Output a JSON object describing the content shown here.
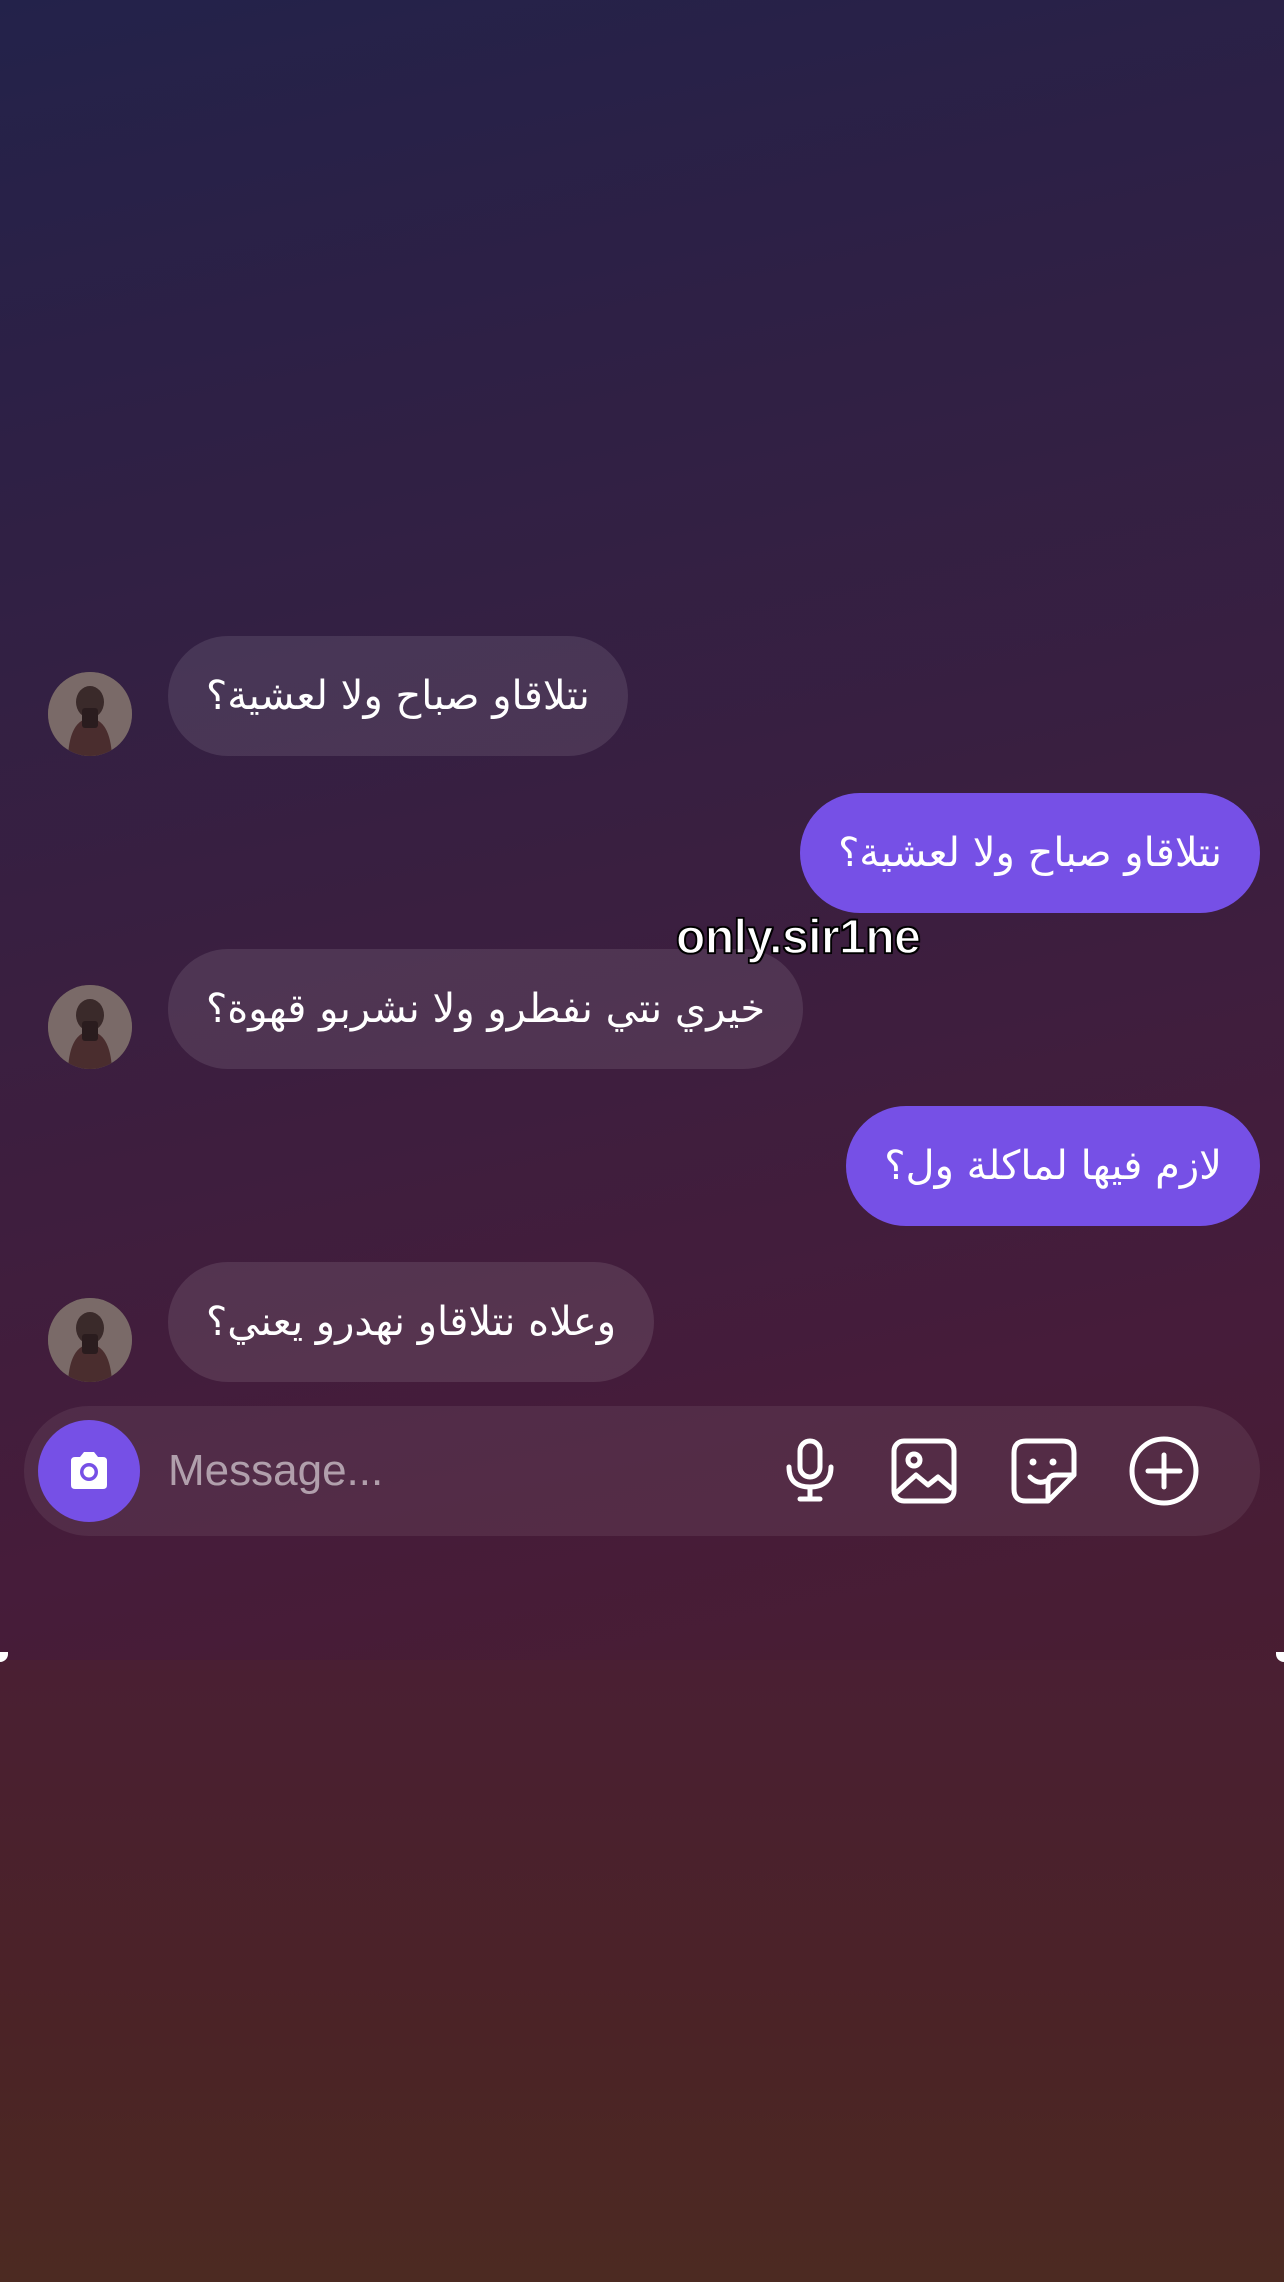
{
  "conversation": {
    "messages": [
      {
        "direction": "incoming",
        "text": "نتلاقاو صباح ولا لعشية؟"
      },
      {
        "direction": "outgoing",
        "text": "نتلاقاو صباح ولا لعشية؟"
      },
      {
        "direction": "incoming",
        "text": "خيري نتي نفطرو ولا نشربو قهوة؟"
      },
      {
        "direction": "outgoing",
        "text": "لازم فيها لماكلة ول؟"
      },
      {
        "direction": "incoming",
        "text": "وعلاه نتلاقاو نهدرو يعني؟"
      }
    ]
  },
  "overlay": {
    "watermark": "only.sir1ne"
  },
  "composer": {
    "placeholder": "Message...",
    "icons": [
      "camera-icon",
      "microphone-icon",
      "image-icon",
      "sticker-icon",
      "plus-circle-icon"
    ]
  },
  "colors": {
    "accent": "#7650e6",
    "incoming_bubble": "rgba(255,255,255,0.10)"
  }
}
